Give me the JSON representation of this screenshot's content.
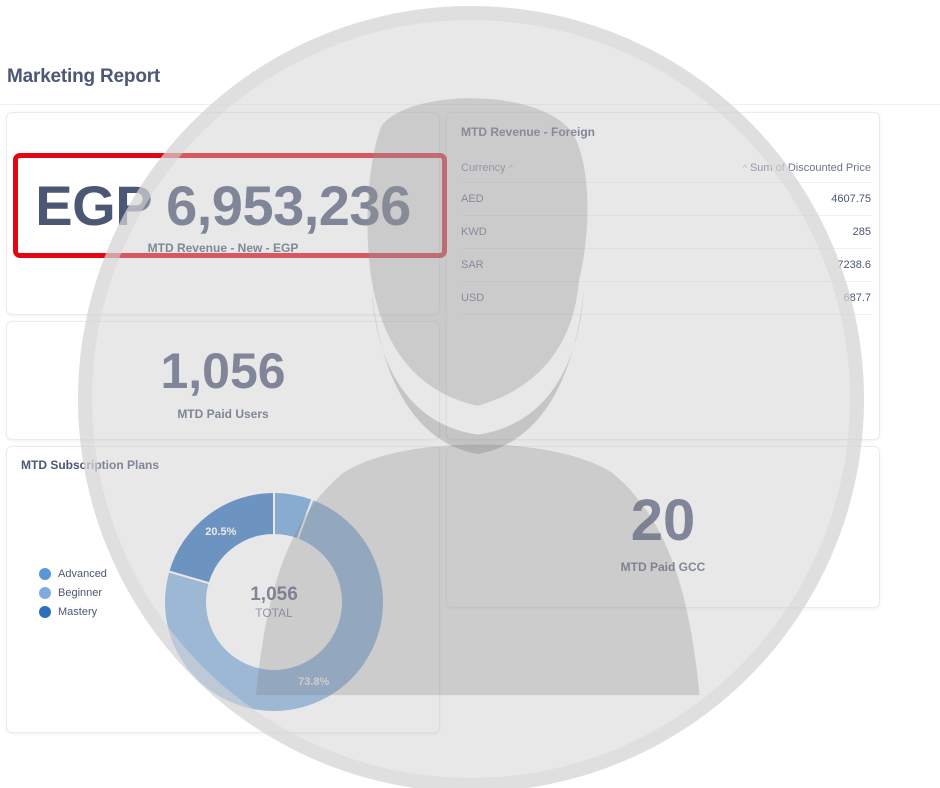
{
  "page": {
    "title": "Marketing Report"
  },
  "revenue_egp": {
    "value": "EGP 6,953,236",
    "label": "MTD Revenue - New - EGP"
  },
  "foreign_revenue": {
    "title": "MTD Revenue - Foreign",
    "columns": [
      "Currency",
      "Sum of Discounted Price"
    ],
    "rows": [
      {
        "currency": "AED",
        "sum": "4607.75"
      },
      {
        "currency": "KWD",
        "sum": "285"
      },
      {
        "currency": "SAR",
        "sum": "7238.6"
      },
      {
        "currency": "USD",
        "sum": "687.7"
      }
    ]
  },
  "paid_users": {
    "value": "1,056",
    "label": "MTD Paid Users"
  },
  "paid_gcc": {
    "value": "20",
    "label": "MTD Paid GCC"
  },
  "subscription_plans": {
    "title": "MTD Subscription Plans",
    "legend": [
      {
        "name": "Advanced",
        "color": "#5b97d6"
      },
      {
        "name": "Beginner",
        "color": "#7facdd"
      },
      {
        "name": "Mastery",
        "color": "#2c6fbb"
      }
    ],
    "center_value": "1,056",
    "center_label": "TOTAL"
  },
  "chart_data": {
    "type": "pie",
    "categories": [
      "Advanced",
      "Beginner",
      "Mastery"
    ],
    "values": [
      5.7,
      73.8,
      20.5
    ],
    "data_labels": [
      "",
      "73.8%",
      "20.5%"
    ],
    "colors": [
      "#5b97d6",
      "#7facdd",
      "#2c6fbb"
    ],
    "title": "MTD Subscription Plans",
    "legend": "left"
  },
  "colors": {
    "text": "#4c5773",
    "highlight": "#e30613",
    "accent": "#509ee3"
  }
}
